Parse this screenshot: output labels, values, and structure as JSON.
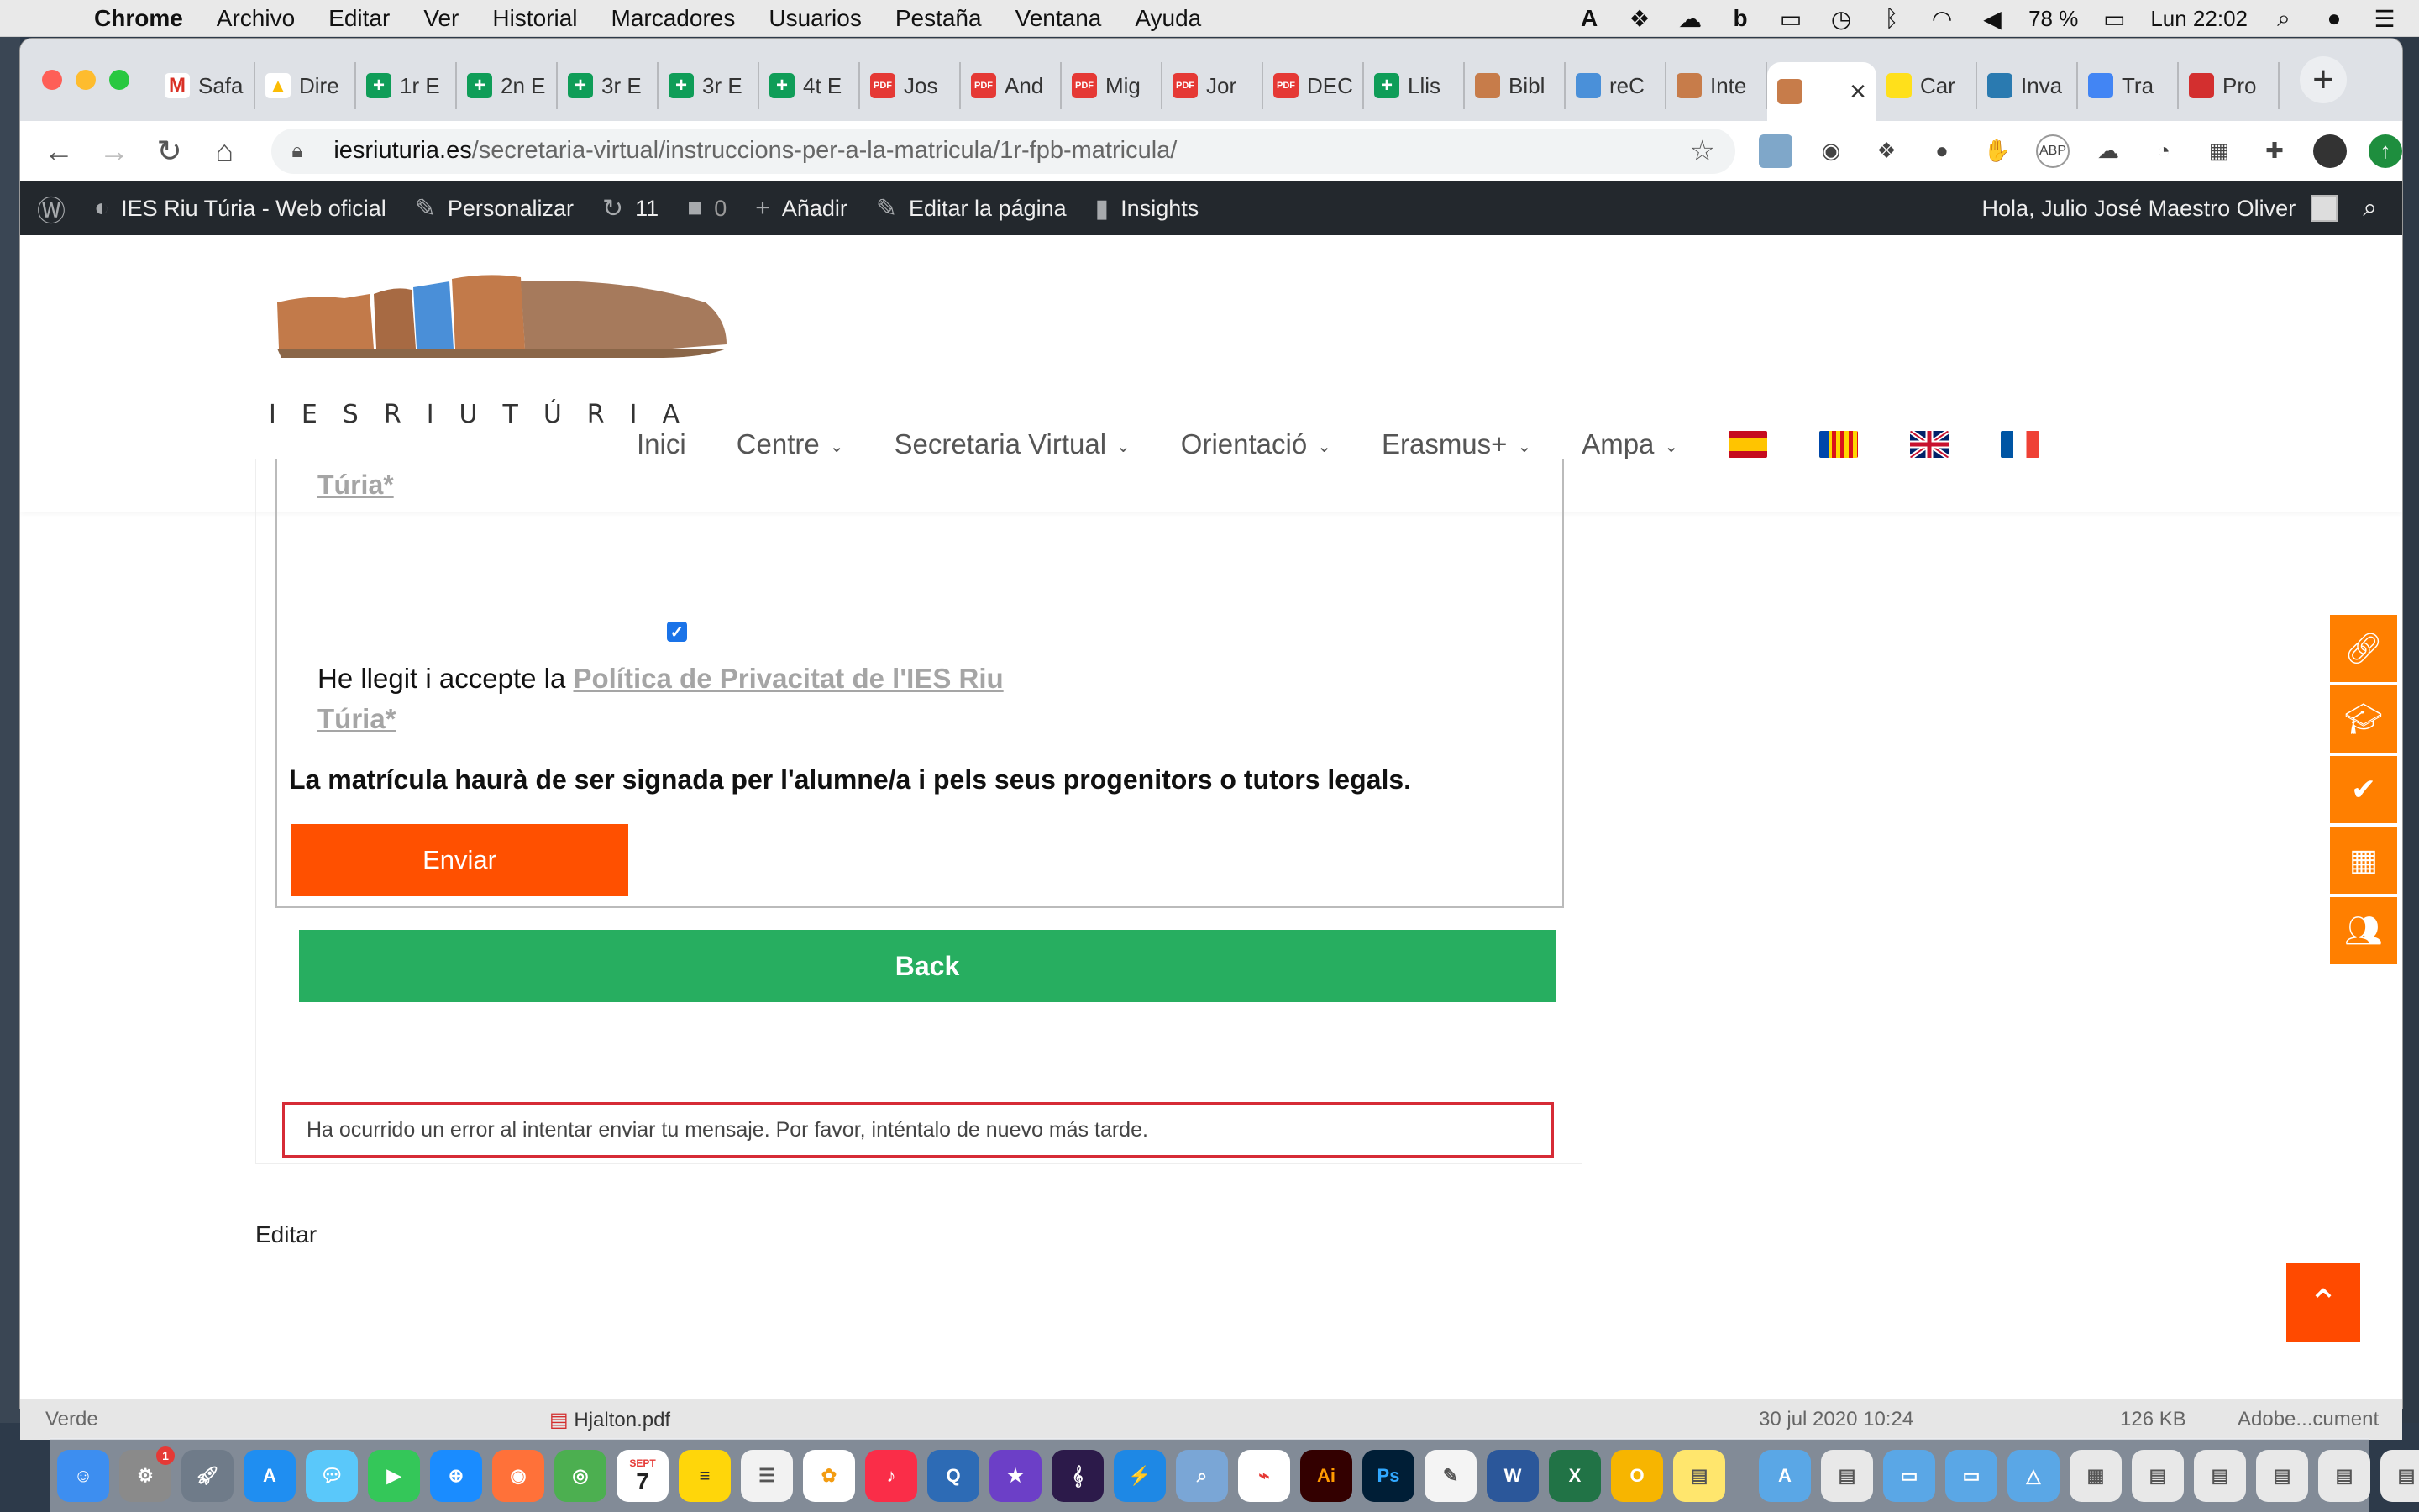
{
  "menubar": {
    "app": "Chrome",
    "items": [
      "Archivo",
      "Editar",
      "Ver",
      "Historial",
      "Marcadores",
      "Usuarios",
      "Pestaña",
      "Ventana",
      "Ayuda"
    ],
    "battery": "78 %",
    "clock": "Lun 22:02"
  },
  "tabs": [
    {
      "label": "Safa",
      "icon": "gmail-icon",
      "color": "#ffffff"
    },
    {
      "label": "Dire",
      "icon": "drive-icon",
      "color": "#ffffff"
    },
    {
      "label": "1r E",
      "icon": "sheets-icon",
      "color": "#0f9d58"
    },
    {
      "label": "2n E",
      "icon": "sheets-icon",
      "color": "#0f9d58"
    },
    {
      "label": "3r E",
      "icon": "sheets-icon",
      "color": "#0f9d58"
    },
    {
      "label": "3r E",
      "icon": "sheets-icon",
      "color": "#0f9d58"
    },
    {
      "label": "4t E",
      "icon": "sheets-icon",
      "color": "#0f9d58"
    },
    {
      "label": "Jos",
      "icon": "pdf-icon",
      "color": "#e53935"
    },
    {
      "label": "And",
      "icon": "pdf-icon",
      "color": "#e53935"
    },
    {
      "label": "Mig",
      "icon": "pdf-icon",
      "color": "#e53935"
    },
    {
      "label": "Jor",
      "icon": "pdf-icon",
      "color": "#e53935"
    },
    {
      "label": "DEC",
      "icon": "pdf-icon",
      "color": "#e53935"
    },
    {
      "label": "Llis",
      "icon": "sheets-icon",
      "color": "#0f9d58"
    },
    {
      "label": "Bibl",
      "icon": "site-icon",
      "color": "#c77c4a"
    },
    {
      "label": "reC",
      "icon": "recaptcha-icon",
      "color": "#4a90d9"
    },
    {
      "label": "Inte",
      "icon": "site-icon",
      "color": "#c77c4a"
    },
    {
      "label": "",
      "icon": "site-icon",
      "color": "#c77c4a",
      "active": true
    },
    {
      "label": "Car",
      "icon": "mailchimp-icon",
      "color": "#ffe01b"
    },
    {
      "label": "Inva",
      "icon": "invalid-icon",
      "color": "#2a7ab0"
    },
    {
      "label": "Tra",
      "icon": "translate-icon",
      "color": "#4285f4"
    },
    {
      "label": "Pro",
      "icon": "pro-icon",
      "color": "#d32f2f"
    }
  ],
  "tab_close": "×",
  "tab_pdf_text": "PDF",
  "address": {
    "host": "iesriuturia.es",
    "path": "/secretaria-virtual/instruccions-per-a-la-matricula/1r-fpb-matricula/"
  },
  "wpbar": {
    "site": "IES Riu Túria - Web oficial",
    "customize": "Personalizar",
    "updates": "11",
    "comments": "0",
    "add": "Añadir",
    "edit_page": "Editar la página",
    "insights": "Insights",
    "greeting": "Hola, Julio José Maestro Oliver"
  },
  "logo_text": "IESRIUTÚRIA",
  "nav": {
    "items": [
      "Inici",
      "Centre",
      "Secretaria Virtual",
      "Orientació",
      "Erasmus+",
      "Ampa"
    ],
    "flags": [
      "flag-es",
      "flag-valencia",
      "flag-uk",
      "flag-fr"
    ]
  },
  "form": {
    "clipped_link_tail": "Túria*",
    "checkbox_checked": true,
    "privacy_prefix": "He llegit i accepte la ",
    "privacy_link_line1": "Política de Privacitat de l'IES Riu",
    "privacy_link_line2": "Túria*",
    "signature_note": "La matrícula haurà de ser signada per l'alumne/a i pels seus progenitors o tutors legals.",
    "submit_label": "Enviar",
    "back_label": "Back",
    "error_message": "Ha ocurrido un error al intentar enviar tu mensaje. Por favor, inténtalo de nuevo más tarde."
  },
  "edit_link": "Editar",
  "side_buttons": [
    "link-icon",
    "graduation-cap-icon",
    "check-icon",
    "building-icon",
    "users-icon"
  ],
  "finder": {
    "left_text": "Verde",
    "file": "Hjalton.pdf",
    "date": "30 jul 2020 10:24",
    "size": "126 KB",
    "kind": "Adobe...cument"
  },
  "dock": {
    "calendar_month": "SEPT",
    "calendar_day": "7",
    "settings_badge": "1"
  },
  "colors": {
    "accent_orange": "#ff5000",
    "back_green": "#27ae60",
    "error_red": "#d62b36",
    "side_orange": "#ff7f00",
    "wp_bar": "#23282d"
  }
}
